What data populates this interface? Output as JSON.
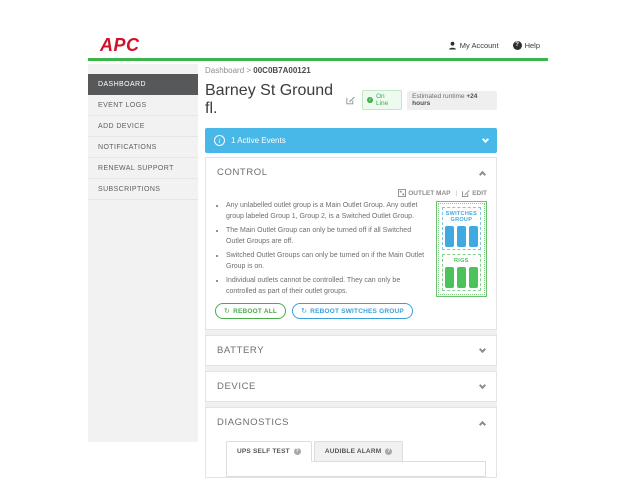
{
  "colors": {
    "brand_red": "#d0112b",
    "line_green": "#3cb54a",
    "banner_blue": "#47b8e8",
    "badge_green": "#3db04b",
    "btn_green": "#4aab49",
    "btn_blue": "#3a9fd8",
    "socket_blue": "#3fa9e0",
    "socket_green": "#4cc35a"
  },
  "topbar": {
    "logo": "APC",
    "account_label": "My Account",
    "help_label": "Help"
  },
  "sidebar": {
    "items": [
      {
        "label": "DASHBOARD",
        "active": true
      },
      {
        "label": "EVENT LOGS"
      },
      {
        "label": "ADD DEVICE"
      },
      {
        "label": "NOTIFICATIONS"
      },
      {
        "label": "RENEWAL SUPPORT"
      },
      {
        "label": "SUBSCRIPTIONS"
      }
    ]
  },
  "breadcrumb": {
    "parent": "Dashboard",
    "separator": ">",
    "current": "00C0B7A00121"
  },
  "device": {
    "title": "Barney St Ground fl.",
    "status": "On Line",
    "status_check": "✓",
    "runtime_prefix": "Estimated runtime",
    "runtime_value": "+24 hours"
  },
  "events_banner": {
    "label": "1 Active Events",
    "info_glyph": "i"
  },
  "control": {
    "title": "CONTROL",
    "outlet_map_link": "OUTLET MAP",
    "link_separator": "|",
    "edit_link": "EDIT",
    "bullets": [
      "Any unlabelled outlet group is a Main Outlet Group. Any outlet group labeled Group 1, Group 2, is a Switched Outlet Group.",
      "The Main Outlet Group can only be turned off if all Switched Outlet Groups are off.",
      "Switched Outlet Groups can only be turned on if the Main Outlet Group is on.",
      "Individual outlets cannot be controlled. They can only be controlled as part of their outlet groups."
    ],
    "reboot_all_label": "REBOOT ALL",
    "reboot_switches_label": "REBOOT SWITCHES GROUP",
    "reboot_glyph": "↻",
    "outlet_map": {
      "groups": [
        {
          "name": "SWITCHES GROUP",
          "color": "#3fa9e0",
          "outlet_count": 3
        },
        {
          "name": "RIGS",
          "color": "#4cc35a",
          "outlet_count": 3
        }
      ]
    }
  },
  "sections": {
    "battery_title": "BATTERY",
    "device_title": "DEVICE",
    "diagnostics_title": "DIAGNOSTICS"
  },
  "diagnostics": {
    "tabs": [
      {
        "label": "UPS SELF TEST",
        "active": true
      },
      {
        "label": "AUDIBLE ALARM",
        "active": false
      }
    ],
    "help_glyph": "?"
  }
}
